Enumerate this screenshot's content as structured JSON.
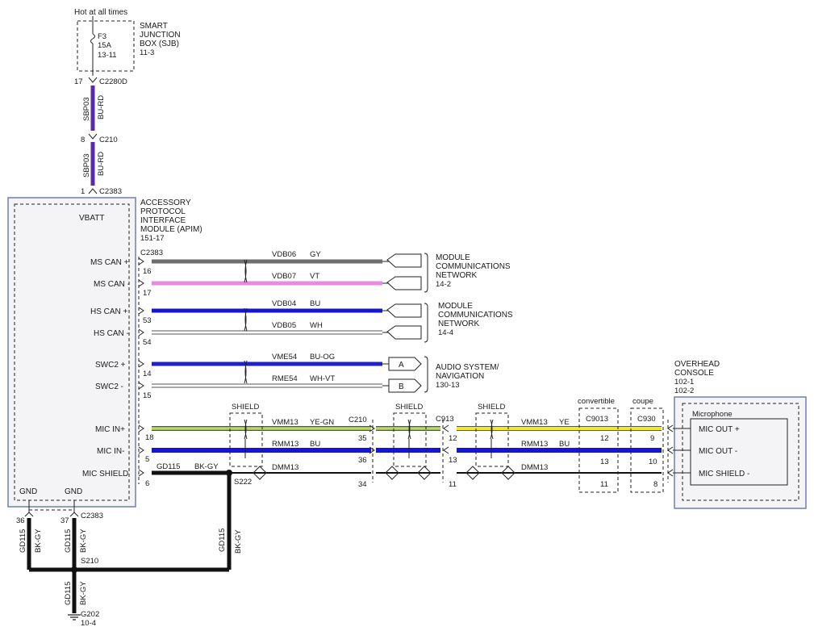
{
  "colors": {
    "GY": "#6e6e6e",
    "VT": "#e58ce0",
    "BU": "#1515d6",
    "WH": "#ffffff",
    "BU-OG": "#2020c8",
    "WH-VT": "#ffffff",
    "YE-GN": "#b6dc5a",
    "YE": "#f3ea1e",
    "BU-RD": "#5b2aa8",
    "BK-GY": "#111111",
    "module_border": "#6f7fb8"
  },
  "power": {
    "label": "Hot at all times",
    "fuse_id": "F3",
    "fuse_rating": "15A",
    "fuse_ref": "13-11"
  },
  "sjb": {
    "line1": "SMART",
    "line2": "JUNCTION",
    "line3": "BOX (SJB)",
    "ref": "11-3"
  },
  "connectors": {
    "c2280d": {
      "pin": "17",
      "name": "C2280D"
    },
    "c210_top": {
      "pin": "8",
      "name": "C210"
    },
    "c2383_top": {
      "pin": "1",
      "name": "C2383"
    },
    "c2383_right": "C2383",
    "c210_mid": "C210",
    "c913": "C913",
    "c9013": "C9013",
    "c930": "C930",
    "c2383_gnd": "C2383"
  },
  "wires_vertical": [
    {
      "circuit": "SBP03",
      "color": "BU-RD"
    },
    {
      "circuit": "SBP03",
      "color": "BU-RD"
    }
  ],
  "apim": {
    "line1": "ACCESSORY",
    "line2": "PROTOCOL",
    "line3": "INTERFACE",
    "line4": "MODULE (APIM)",
    "ref": "151-17",
    "vbatt": "VBATT",
    "gnd1": "GND",
    "gnd2": "GND"
  },
  "pins": [
    {
      "label": "MS CAN +",
      "pin": "16",
      "circuit": "VDB06",
      "color": "GY"
    },
    {
      "label": "MS CAN -",
      "pin": "17",
      "circuit": "VDB07",
      "color": "VT"
    },
    {
      "label": "HS CAN +",
      "pin": "53",
      "circuit": "VDB04",
      "color": "BU"
    },
    {
      "label": "HS CAN -",
      "pin": "54",
      "circuit": "VDB05",
      "color": "WH"
    },
    {
      "label": "SWC2 +",
      "pin": "14",
      "circuit": "VME54",
      "color": "BU-OG"
    },
    {
      "label": "SWC2 -",
      "pin": "15",
      "circuit": "RME54",
      "color": "WH-VT"
    }
  ],
  "ref_blocks": [
    {
      "l1": "MODULE",
      "l2": "COMMUNICATIONS",
      "l3": "NETWORK",
      "ref": "14-2"
    },
    {
      "l1": "MODULE",
      "l2": "COMMUNICATIONS",
      "l3": "NETWORK",
      "ref": "14-4"
    },
    {
      "l1": "AUDIO SYSTEM/",
      "l2": "NAVIGATION",
      "l3": "",
      "ref": "130-13"
    }
  ],
  "tags": {
    "a": "A",
    "b": "B"
  },
  "mic": {
    "in_plus": {
      "label": "MIC IN+",
      "pin": "18",
      "circuit": "VMM13",
      "color": "YE-GN"
    },
    "in_minus": {
      "label": "MIC IN-",
      "pin": "5",
      "circuit": "RMM13",
      "color": "BU"
    },
    "shield": {
      "label": "MIC SHIELD",
      "pin": "6",
      "circuit": "GD115",
      "color": "BK-GY",
      "circuit2": "DMM13"
    },
    "right_in_plus": {
      "circuit": "VMM13",
      "color": "YE"
    },
    "right_in_minus": {
      "circuit": "RMM13",
      "color": "BU"
    },
    "right_shield": {
      "circuit": "DMM13"
    }
  },
  "splices": {
    "s222": "S222",
    "s210": "S210"
  },
  "c210_pins": [
    "35",
    "36",
    "34"
  ],
  "c913_pins": [
    "12",
    "13",
    "11"
  ],
  "c9013_pins": [
    "12",
    "13",
    "11"
  ],
  "c930_pins": [
    "9",
    "10",
    "8"
  ],
  "shield_label": "SHIELD",
  "variant": {
    "convertible": "convertible",
    "coupe": "coupe"
  },
  "overhead": {
    "l1": "OVERHEAD",
    "l2": "CONSOLE",
    "ref1": "102-1",
    "ref2": "102-2",
    "inner": "Microphone",
    "out_plus": "MIC OUT +",
    "out_minus": "MIC OUT -",
    "out_shield": "MIC SHIELD -"
  },
  "ground": {
    "pin36": "36",
    "pin37": "37",
    "circuit": "GD115",
    "color": "BK-GY",
    "g202": "G202",
    "g202_ref": "10-4"
  }
}
